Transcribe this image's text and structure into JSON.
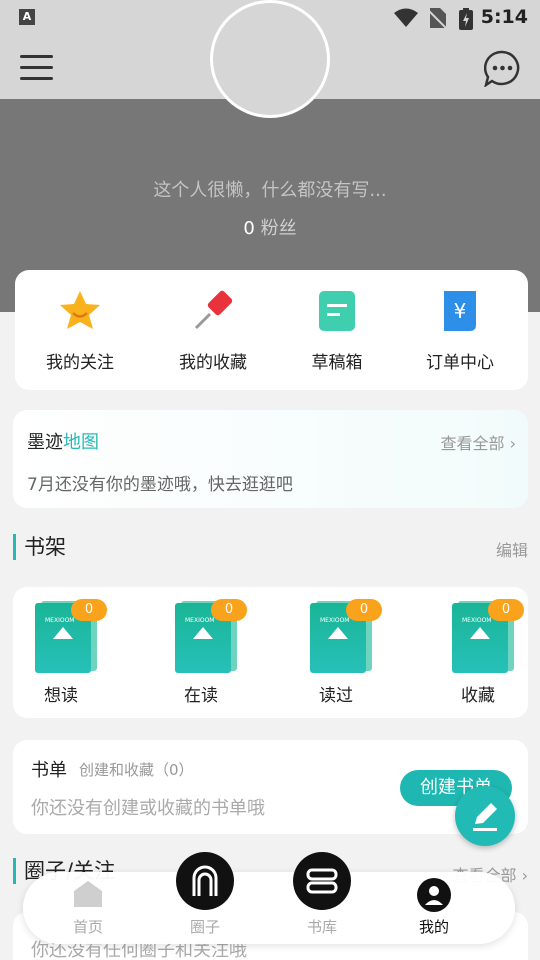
{
  "status": {
    "app_icon": "A",
    "time": "5:14"
  },
  "profile": {
    "bio": "这个人很懒，什么都没有写...",
    "fans_count": "0",
    "fans_label": "粉丝"
  },
  "quick_actions": [
    {
      "label": "我的关注",
      "icon": "star-icon"
    },
    {
      "label": "我的收藏",
      "icon": "pin-icon"
    },
    {
      "label": "草稿箱",
      "icon": "draft-icon"
    },
    {
      "label": "订单中心",
      "icon": "order-icon"
    }
  ],
  "map": {
    "title_a": "墨迹",
    "title_b": "地图",
    "more": "查看全部",
    "desc": "7月还没有你的墨迹哦，快去逛逛吧"
  },
  "shelf": {
    "title": "书架",
    "edit": "编辑",
    "books": [
      {
        "label": "想读",
        "count": "0",
        "logo": "MEXIOOM"
      },
      {
        "label": "在读",
        "count": "0",
        "logo": "MEXIOOM"
      },
      {
        "label": "读过",
        "count": "0",
        "logo": "MEXIOOM"
      },
      {
        "label": "收藏",
        "count": "0",
        "logo": "MEXIOOM"
      }
    ]
  },
  "booklist": {
    "title": "书单",
    "subtitle": "创建和收藏（0）",
    "desc": "你还没有创建或收藏的书单哦",
    "create": "创建书单"
  },
  "circle": {
    "title": "圈子/关注",
    "more": "查看全部",
    "desc": "你还没有任何圈子和关注哦"
  },
  "tabs": [
    {
      "label": "首页",
      "icon": "home-icon"
    },
    {
      "label": "圈子",
      "icon": "circle-icon"
    },
    {
      "label": "书库",
      "icon": "library-icon"
    },
    {
      "label": "我的",
      "icon": "profile-icon"
    }
  ],
  "colors": {
    "accent": "#26b9b4",
    "badge": "#f9a21b"
  }
}
